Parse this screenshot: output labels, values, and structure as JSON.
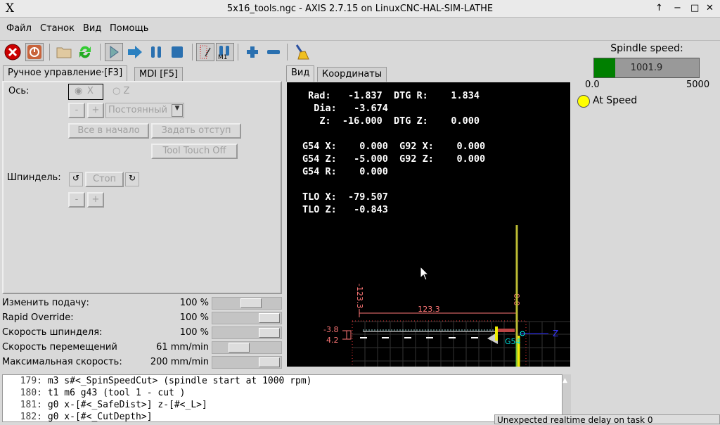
{
  "window": {
    "title": "5x16_tools.ngc - AXIS 2.7.15 on LinuxCNC-HAL-SIM-LATHE",
    "logo": "X",
    "controls": [
      "↑",
      "−",
      "□",
      "✕"
    ]
  },
  "menu": [
    "Файл",
    "Станок",
    "Вид",
    "Помощь"
  ],
  "toolbar": {
    "icons": [
      "estop-icon",
      "power-icon",
      "open-file-icon",
      "reload-icon",
      "run-icon",
      "step-icon",
      "pause-icon",
      "stop-icon",
      "block-delete-icon",
      "optional-stop-icon",
      "zoom-in-icon",
      "zoom-out-icon",
      "clear-plot-icon"
    ],
    "m1_label": "M1"
  },
  "left_tabs": [
    "Ручное управление·[F3]",
    "MDI [F5]"
  ],
  "manual": {
    "axis_label": "Ось:",
    "axis_x": "X",
    "axis_z": "Z",
    "minus": "-",
    "plus": "+",
    "jog_mode": "Постоянный",
    "home_all": "Все в начало",
    "touch_off": "Задать отступ",
    "tool_touch_off": "Tool Touch Off",
    "spindle_label": "Шпиндель:",
    "spindle_stop": "Стоп",
    "sp_minus": "-",
    "sp_plus": "+"
  },
  "overrides": [
    {
      "label": "Изменить подачу:",
      "value": "100 %",
      "fraction": 0.6
    },
    {
      "label": "Rapid Override:",
      "value": "100 %",
      "fraction": 1.0
    },
    {
      "label": "Скорость шпинделя:",
      "value": "100 %",
      "fraction": 1.0
    },
    {
      "label": "Скорость перемещений",
      "value": "61 mm/min",
      "fraction": 0.35
    },
    {
      "label": "Максимальная скорость:",
      "value": "200 mm/min",
      "fraction": 1.0
    }
  ],
  "view_tabs": [
    "Вид",
    "Координаты"
  ],
  "dro": [
    " Rad:   -1.837  DTG R:    1.834",
    "  Dia:   -3.674",
    "   Z:  -16.000  DTG Z:    0.000",
    "",
    "G54 X:    0.000  G92 X:    0.000",
    "G54 Z:   -5.000  G92 Z:    0.000",
    "G54 R:    0.000",
    "",
    "TLO X:  -79.507",
    "TLO Z:   -0.843"
  ],
  "plot": {
    "dim_vertical": "-123.3",
    "dim_horizontal": "123.3",
    "dim_zero": "0.0",
    "x_min": "-3.8",
    "x_max": "4.2",
    "axis_z": "Z",
    "g54": "G54"
  },
  "code": [
    {
      "n": "179:",
      "t": "m3 s#<_SpinSpeedCut> (spindle start at 1000 rpm)"
    },
    {
      "n": "180:",
      "t": "t1 m6 g43 (tool 1 - cut )"
    },
    {
      "n": "181:",
      "t": "g0 x-[#<_SafeDist>] z-[#<_L>]"
    },
    {
      "n": "182:",
      "t": "g0 x-[#<_CutDepth>]"
    }
  ],
  "status_message": "Unexpected realtime delay on task 0",
  "spindle": {
    "title": "Spindle speed:",
    "value": "1001.9",
    "min": "0.0",
    "max": "5000",
    "fraction": 0.2,
    "at_speed": "At Speed",
    "bar_color": "#007f00",
    "led_color": "#ffff00"
  }
}
